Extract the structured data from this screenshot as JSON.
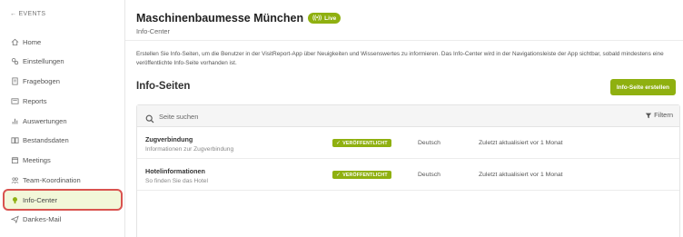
{
  "sidebar": {
    "back_label": "← EVENTS",
    "items": [
      {
        "label": "Home",
        "icon": "home-icon"
      },
      {
        "label": "Einstellungen",
        "icon": "settings-icon"
      },
      {
        "label": "Fragebogen",
        "icon": "questionnaire-icon"
      },
      {
        "label": "Reports",
        "icon": "reports-icon"
      },
      {
        "label": "Auswertungen",
        "icon": "chart-icon"
      },
      {
        "label": "Bestandsdaten",
        "icon": "book-icon"
      },
      {
        "label": "Meetings",
        "icon": "calendar-icon"
      },
      {
        "label": "Team-Koordination",
        "icon": "team-icon"
      },
      {
        "label": "Info-Center",
        "icon": "bulb-icon",
        "active": true
      },
      {
        "label": "Dankes-Mail",
        "icon": "send-icon"
      }
    ]
  },
  "header": {
    "title": "Maschinenbaumesse München",
    "live_badge": "Live",
    "subtitle": "Info-Center"
  },
  "description": "Erstellen Sie Info-Seiten, um die Benutzer in der VisitReport-App über Neuigkeiten und Wissenswertes zu informieren. Das Info-Center wird in der Navigationsleiste der App sichtbar, sobald mindestens eine veröffentlichte Info-Seite vorhanden ist.",
  "section": {
    "title": "Info-Seiten",
    "create_button": "Info-Seite erstellen"
  },
  "search": {
    "placeholder": "Seite suchen",
    "value": "",
    "filter_label": "Filtern"
  },
  "rows": [
    {
      "title": "Zugverbindung",
      "subtitle": "Informationen zur Zugverbindung",
      "status": "VERÖFFENTLICHT",
      "language": "Deutsch",
      "updated": "Zuletzt aktualisiert vor 1 Monat"
    },
    {
      "title": "Hotelinformationen",
      "subtitle": "So finden Sie das Hotel",
      "status": "VERÖFFENTLICHT",
      "language": "Deutsch",
      "updated": "Zuletzt aktualisiert vor 1 Monat"
    }
  ],
  "colors": {
    "accent": "#8fb010",
    "active_bg": "#f2f7d9",
    "highlight_border": "#d9534f"
  }
}
